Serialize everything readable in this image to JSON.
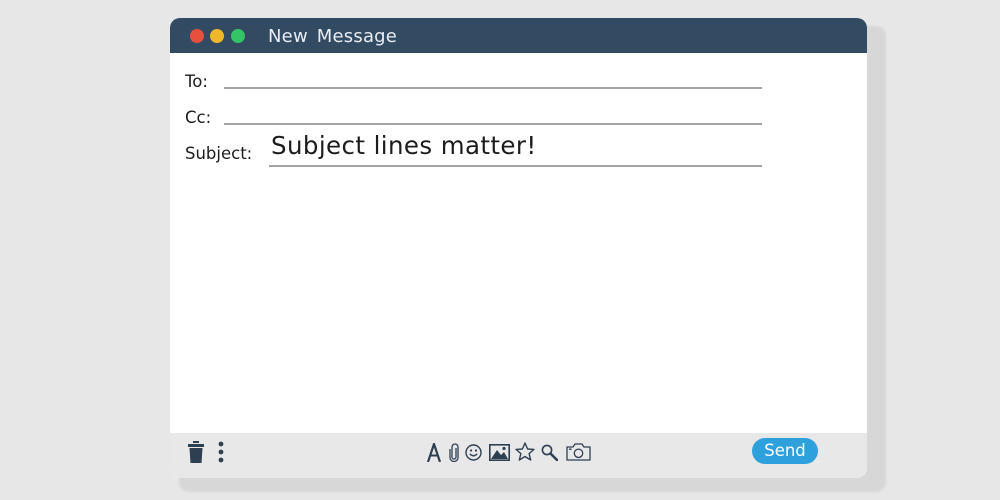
{
  "window": {
    "title": "New Message"
  },
  "fields": {
    "to_label": "To:",
    "to_value": "",
    "cc_label": "Cc:",
    "cc_value": "",
    "subject_label": "Subject:",
    "subject_value": "Subject lines matter!"
  },
  "toolbar": {
    "left_icons": [
      "trash-icon",
      "more-options-icon"
    ],
    "format_icons": [
      "text-format-icon",
      "paperclip-icon",
      "emoji-icon",
      "image-icon",
      "star-icon",
      "search-icon",
      "camera-icon"
    ],
    "send_label": "Send"
  },
  "colors": {
    "titlebar": "#334a63",
    "close": "#e8503e",
    "minimize": "#efb82a",
    "maximize": "#34c467",
    "send": "#2ea1dd",
    "toolbar": "#e8e8e8",
    "icons": "#2f3f52"
  }
}
